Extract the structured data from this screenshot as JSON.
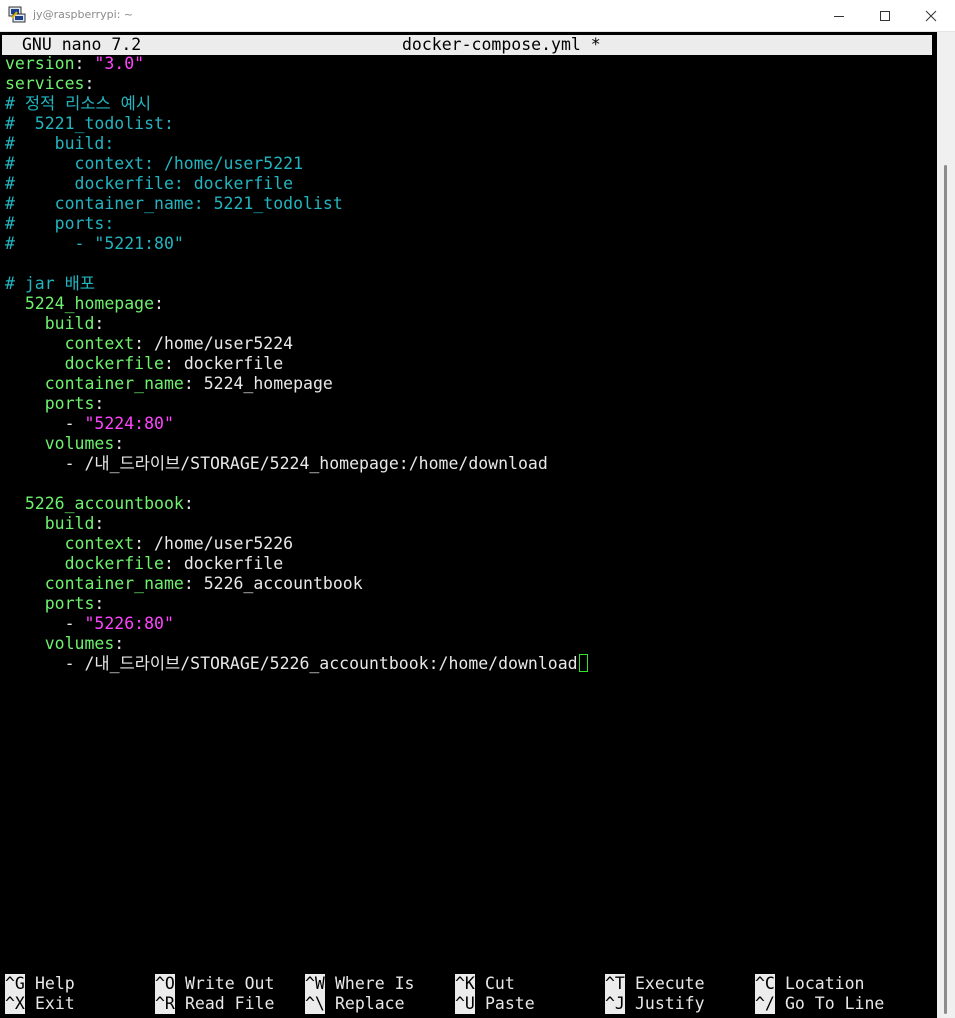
{
  "window": {
    "title": "jy@raspberrypi: ~",
    "icon": "putty-icon"
  },
  "nano": {
    "version_label": "GNU nano 7.2",
    "filename": "docker-compose.yml *"
  },
  "file_lines": [
    [
      [
        "key",
        "version"
      ],
      [
        "plain",
        ": "
      ],
      [
        "str",
        "\"3.0\""
      ]
    ],
    [
      [
        "key",
        "services"
      ],
      [
        "plain",
        ":"
      ]
    ],
    [
      [
        "com",
        "# 정적 리소스 예시"
      ]
    ],
    [
      [
        "com",
        "#  5221_todolist:"
      ]
    ],
    [
      [
        "com",
        "#    build:"
      ]
    ],
    [
      [
        "com",
        "#      context: /home/user5221"
      ]
    ],
    [
      [
        "com",
        "#      dockerfile: dockerfile"
      ]
    ],
    [
      [
        "com",
        "#    container_name: 5221_todolist"
      ]
    ],
    [
      [
        "com",
        "#    ports:"
      ]
    ],
    [
      [
        "com",
        "#      - \"5221:80\""
      ]
    ],
    [],
    [
      [
        "com",
        "# jar 배포"
      ]
    ],
    [
      [
        "plain",
        "  "
      ],
      [
        "key",
        "5224_homepage"
      ],
      [
        "plain",
        ":"
      ]
    ],
    [
      [
        "plain",
        "    "
      ],
      [
        "key",
        "build"
      ],
      [
        "plain",
        ":"
      ]
    ],
    [
      [
        "plain",
        "      "
      ],
      [
        "key",
        "context"
      ],
      [
        "plain",
        ": /home/user5224"
      ]
    ],
    [
      [
        "plain",
        "      "
      ],
      [
        "key",
        "dockerfile"
      ],
      [
        "plain",
        ": dockerfile"
      ]
    ],
    [
      [
        "plain",
        "    "
      ],
      [
        "key",
        "container_name"
      ],
      [
        "plain",
        ": 5224_homepage"
      ]
    ],
    [
      [
        "plain",
        "    "
      ],
      [
        "key",
        "ports"
      ],
      [
        "plain",
        ":"
      ]
    ],
    [
      [
        "plain",
        "      - "
      ],
      [
        "str",
        "\"5224:80\""
      ]
    ],
    [
      [
        "plain",
        "    "
      ],
      [
        "key",
        "volumes"
      ],
      [
        "plain",
        ":"
      ]
    ],
    [
      [
        "plain",
        "      - /내_드라이브/STORAGE/5224_homepage:/home/download"
      ]
    ],
    [],
    [
      [
        "plain",
        "  "
      ],
      [
        "key",
        "5226_accountbook"
      ],
      [
        "plain",
        ":"
      ]
    ],
    [
      [
        "plain",
        "    "
      ],
      [
        "key",
        "build"
      ],
      [
        "plain",
        ":"
      ]
    ],
    [
      [
        "plain",
        "      "
      ],
      [
        "key",
        "context"
      ],
      [
        "plain",
        ": /home/user5226"
      ]
    ],
    [
      [
        "plain",
        "      "
      ],
      [
        "key",
        "dockerfile"
      ],
      [
        "plain",
        ": dockerfile"
      ]
    ],
    [
      [
        "plain",
        "    "
      ],
      [
        "key",
        "container_name"
      ],
      [
        "plain",
        ": 5226_accountbook"
      ]
    ],
    [
      [
        "plain",
        "    "
      ],
      [
        "key",
        "ports"
      ],
      [
        "plain",
        ":"
      ]
    ],
    [
      [
        "plain",
        "      - "
      ],
      [
        "str",
        "\"5226:80\""
      ]
    ],
    [
      [
        "plain",
        "    "
      ],
      [
        "key",
        "volumes"
      ],
      [
        "plain",
        ":"
      ]
    ],
    [
      [
        "plain",
        "      - /내_드라이브/STORAGE/5226_accountbook:/home/download"
      ]
    ]
  ],
  "shortcuts": [
    {
      "key": "^G",
      "label": "Help"
    },
    {
      "key": "^O",
      "label": "Write Out"
    },
    {
      "key": "^W",
      "label": "Where Is"
    },
    {
      "key": "^K",
      "label": "Cut"
    },
    {
      "key": "^T",
      "label": "Execute"
    },
    {
      "key": "^C",
      "label": "Location"
    },
    {
      "key": "^X",
      "label": "Exit"
    },
    {
      "key": "^R",
      "label": "Read File"
    },
    {
      "key": "^\\",
      "label": "Replace"
    },
    {
      "key": "^U",
      "label": "Paste"
    },
    {
      "key": "^J",
      "label": "Justify"
    },
    {
      "key": "^/",
      "label": "Go To Line"
    }
  ],
  "colors": {
    "key": "#6ef26e",
    "string": "#ff44ff",
    "comment": "#22b4bf",
    "text": "#e8e8e8",
    "background": "#000000",
    "cursor": "#2ee52e"
  }
}
